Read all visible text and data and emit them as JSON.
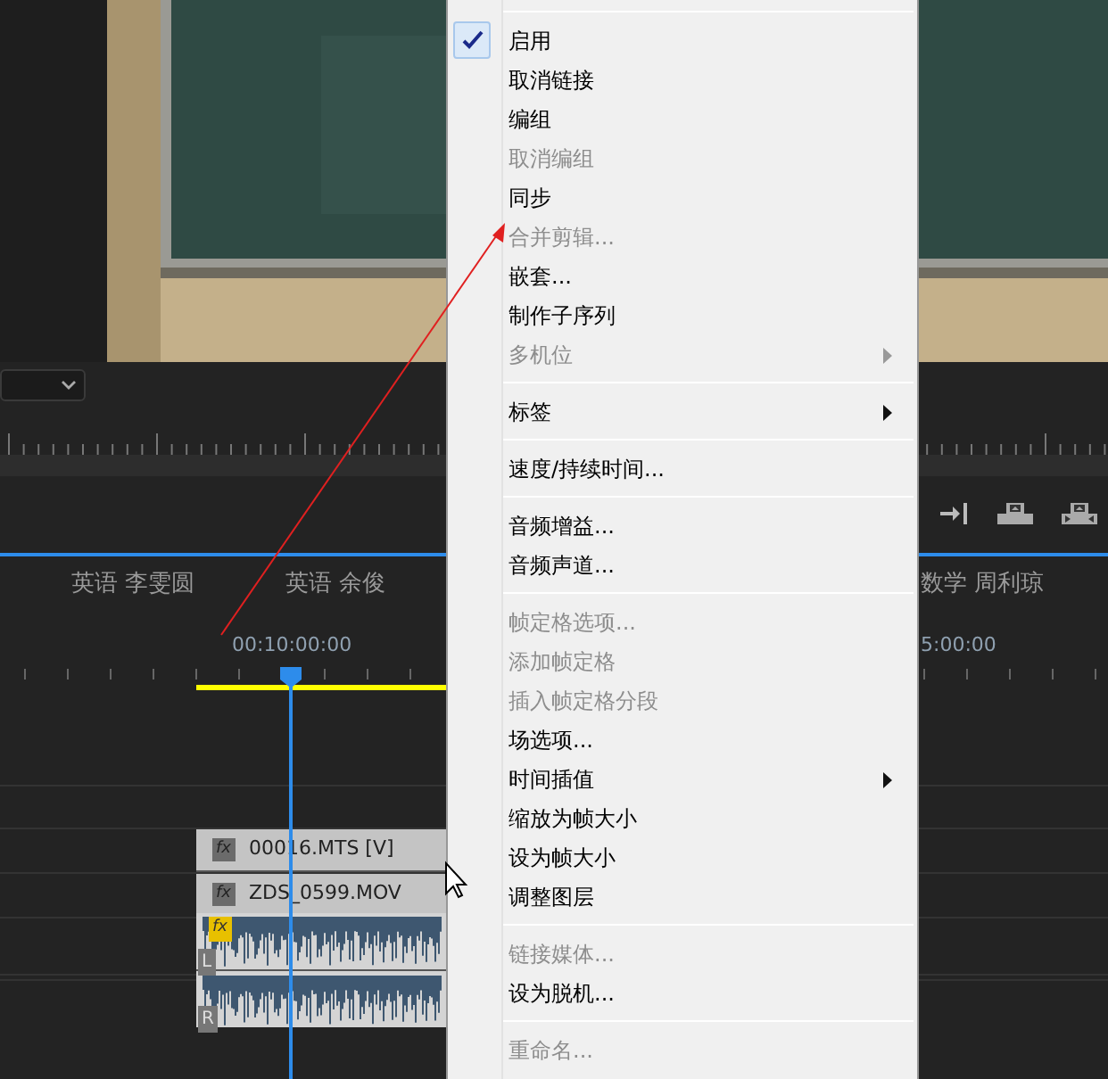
{
  "sequence_tabs": [
    {
      "label": "英语 李雯圆",
      "selected": false
    },
    {
      "label": "英语 余俊",
      "selected": false
    },
    {
      "label": "数学 周利琼",
      "selected": false
    }
  ],
  "timeline": {
    "timecodes": [
      "00:10:00:00",
      "5:00:00"
    ],
    "clips": [
      {
        "name": "00016.MTS [V]",
        "kind": "video",
        "badge": "fx"
      },
      {
        "name": "ZDS_0599.MOV",
        "kind": "video",
        "badge": "fx"
      },
      {
        "kind": "audio",
        "badge": "fx",
        "channels": [
          "L",
          "R"
        ]
      }
    ]
  },
  "context_menu": {
    "items": [
      {
        "kind": "separator"
      },
      {
        "kind": "item",
        "label": "启用",
        "disabled": false,
        "checked": true,
        "submenu": false
      },
      {
        "kind": "item",
        "label": "取消链接",
        "disabled": false,
        "checked": false,
        "submenu": false
      },
      {
        "kind": "item",
        "label": "编组",
        "disabled": false,
        "checked": false,
        "submenu": false
      },
      {
        "kind": "item",
        "label": "取消编组",
        "disabled": true,
        "checked": false,
        "submenu": false
      },
      {
        "kind": "item",
        "label": "同步",
        "disabled": false,
        "checked": false,
        "submenu": false
      },
      {
        "kind": "item",
        "label": "合并剪辑...",
        "disabled": true,
        "checked": false,
        "submenu": false
      },
      {
        "kind": "item",
        "label": "嵌套...",
        "disabled": false,
        "checked": false,
        "submenu": false
      },
      {
        "kind": "item",
        "label": "制作子序列",
        "disabled": false,
        "checked": false,
        "submenu": false
      },
      {
        "kind": "item",
        "label": "多机位",
        "disabled": true,
        "checked": false,
        "submenu": true
      },
      {
        "kind": "separator"
      },
      {
        "kind": "item",
        "label": "标签",
        "disabled": false,
        "checked": false,
        "submenu": true
      },
      {
        "kind": "separator"
      },
      {
        "kind": "item",
        "label": "速度/持续时间...",
        "disabled": false,
        "checked": false,
        "submenu": false
      },
      {
        "kind": "separator"
      },
      {
        "kind": "item",
        "label": "音频增益...",
        "disabled": false,
        "checked": false,
        "submenu": false
      },
      {
        "kind": "item",
        "label": "音频声道...",
        "disabled": false,
        "checked": false,
        "submenu": false
      },
      {
        "kind": "separator"
      },
      {
        "kind": "item",
        "label": "帧定格选项...",
        "disabled": true,
        "checked": false,
        "submenu": false
      },
      {
        "kind": "item",
        "label": "添加帧定格",
        "disabled": true,
        "checked": false,
        "submenu": false
      },
      {
        "kind": "item",
        "label": "插入帧定格分段",
        "disabled": true,
        "checked": false,
        "submenu": false
      },
      {
        "kind": "item",
        "label": "场选项...",
        "disabled": false,
        "checked": false,
        "submenu": false
      },
      {
        "kind": "item",
        "label": "时间插值",
        "disabled": false,
        "checked": false,
        "submenu": true
      },
      {
        "kind": "item",
        "label": "缩放为帧大小",
        "disabled": false,
        "checked": false,
        "submenu": false
      },
      {
        "kind": "item",
        "label": "设为帧大小",
        "disabled": false,
        "checked": false,
        "submenu": false
      },
      {
        "kind": "item",
        "label": "调整图层",
        "disabled": false,
        "checked": false,
        "submenu": false
      },
      {
        "kind": "separator"
      },
      {
        "kind": "item",
        "label": "链接媒体...",
        "disabled": true,
        "checked": false,
        "submenu": false
      },
      {
        "kind": "item",
        "label": "设为脱机...",
        "disabled": false,
        "checked": false,
        "submenu": false
      },
      {
        "kind": "separator"
      },
      {
        "kind": "item",
        "label": "重命名...",
        "disabled": true,
        "checked": false,
        "submenu": false
      }
    ]
  }
}
